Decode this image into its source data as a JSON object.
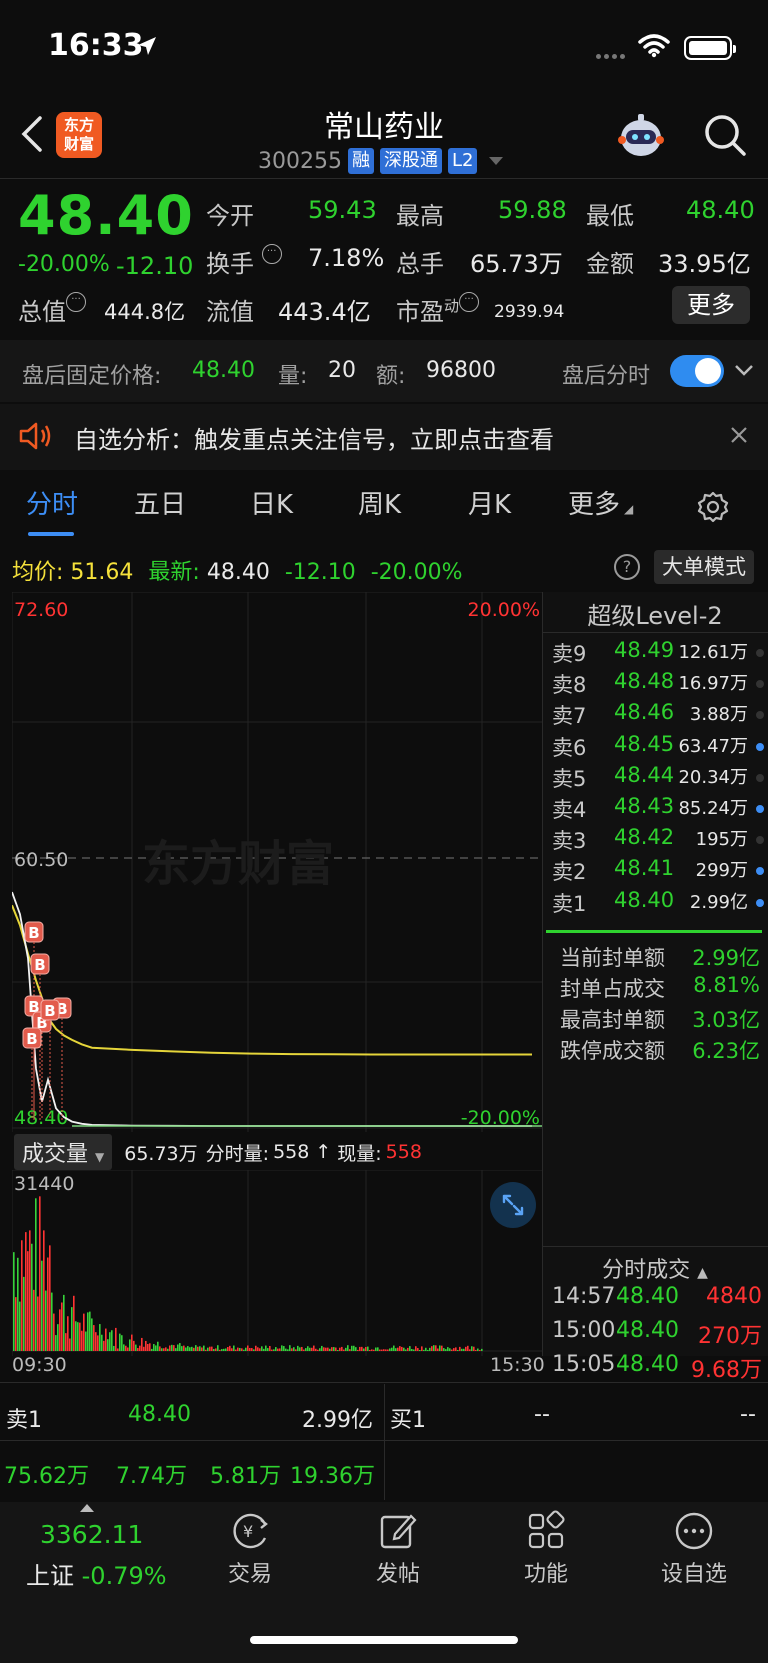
{
  "status": {
    "time": "16:33"
  },
  "header": {
    "logo_line1": "东方",
    "logo_line2": "财富",
    "title": "常山药业",
    "code": "300255",
    "tags": [
      "融",
      "深股通",
      "L2"
    ]
  },
  "quote": {
    "price": "48.40",
    "pct": "-20.00%",
    "chg": "-12.10",
    "open_label": "今开",
    "open": "59.43",
    "high_label": "最高",
    "high": "59.88",
    "low_label": "最低",
    "low": "48.40",
    "turnover_label": "换手",
    "turnover": "7.18%",
    "volume_label": "总手",
    "volume": "65.73万",
    "amount_label": "金额",
    "amount": "33.95亿",
    "mktcap_label": "总值",
    "mktcap": "444.8亿",
    "float_label": "流值",
    "float": "443.4亿",
    "pe_label": "市盈",
    "pe_sup": "动",
    "pe": "2939.94",
    "more": "更多"
  },
  "postmarket": {
    "label": "盘后固定价格:",
    "price": "48.40",
    "vol_label": "量:",
    "vol": "20",
    "amt_label": "额:",
    "amt": "96800",
    "toggle_label": "盘后分时"
  },
  "notice": {
    "text": "自选分析：触发重点关注信号，立即点击查看"
  },
  "tabs": [
    {
      "label": "分时",
      "active": true
    },
    {
      "label": "五日"
    },
    {
      "label": "日K"
    },
    {
      "label": "周K"
    },
    {
      "label": "月K"
    },
    {
      "label": "更多"
    }
  ],
  "info": {
    "avg_label": "均价:",
    "avg": "51.64",
    "last_label": "最新:",
    "last": "48.40",
    "chg": "-12.10",
    "pct": "-20.00%",
    "mode_btn": "大单模式"
  },
  "chart_data": {
    "type": "line",
    "y_top_label": "72.60",
    "y_mid_label": "60.50",
    "y_bottom_label": "48.40",
    "pct_top_label": "20.00%",
    "pct_bottom_label": "-20.00%",
    "watermark": "东方财富",
    "ylim": [
      48.4,
      72.6
    ],
    "series": [
      {
        "values": [
          58.4,
          57.5,
          56.2,
          55.0,
          54.2,
          53.3,
          52.8,
          52.5,
          52.3,
          52.1,
          51.95,
          51.85,
          51.78,
          51.72,
          51.68,
          51.66,
          51.65,
          51.64,
          51.64,
          51.64,
          51.64,
          51.64
        ]
      },
      {
        "values": [
          59.0,
          58.0,
          56.0,
          51.0,
          49.5,
          50.5,
          49.2,
          48.8,
          48.6,
          48.5,
          48.45,
          48.42,
          48.41,
          48.4,
          48.4,
          48.4,
          48.4,
          48.4,
          48.4,
          48.4,
          48.4,
          48.4
        ]
      }
    ],
    "buy_markers": [
      "B",
      "B",
      "B",
      "B",
      "B",
      "B",
      "B"
    ],
    "volume": {
      "label": "成交量",
      "total": "65.73万",
      "min_label": "分时量:",
      "min_vol": "558",
      "now_label": "现量:",
      "now_vol": "558",
      "ymax_label": "31440",
      "x_start": "09:30",
      "x_end": "15:30"
    }
  },
  "level2": {
    "title": "超级Level-2",
    "asks": [
      {
        "k": "卖9",
        "p": "48.49",
        "q": "12.61万",
        "dot": false
      },
      {
        "k": "卖8",
        "p": "48.48",
        "q": "16.97万",
        "dot": false
      },
      {
        "k": "卖7",
        "p": "48.46",
        "q": "3.88万",
        "dot": false
      },
      {
        "k": "卖6",
        "p": "48.45",
        "q": "63.47万",
        "dot": true
      },
      {
        "k": "卖5",
        "p": "48.44",
        "q": "20.34万",
        "dot": false
      },
      {
        "k": "卖4",
        "p": "48.43",
        "q": "85.24万",
        "dot": true
      },
      {
        "k": "卖3",
        "p": "48.42",
        "q": "195万",
        "dot": false
      },
      {
        "k": "卖2",
        "p": "48.41",
        "q": "299万",
        "dot": true
      },
      {
        "k": "卖1",
        "p": "48.40",
        "q": "2.99亿",
        "dot": true
      }
    ],
    "seal": [
      {
        "k": "当前封单额",
        "v": "2.99亿"
      },
      {
        "k": "封单占成交",
        "v": "8.81%"
      },
      {
        "k": "最高封单额",
        "v": "3.03亿"
      },
      {
        "k": "跌停成交额",
        "v": "6.23亿"
      }
    ],
    "trades_title": "分时成交",
    "trades": [
      {
        "t": "14:57",
        "p": "48.40",
        "q": "4840"
      },
      {
        "t": "15:00",
        "p": "48.40",
        "q": "270万"
      },
      {
        "t": "15:05",
        "p": "48.40",
        "q": "9.68万"
      }
    ]
  },
  "orderbook": {
    "sell_label": "卖1",
    "sell_price": "48.40",
    "sell_vol": "2.99亿",
    "buy_label": "买1",
    "buy_price": "--",
    "buy_vol": "--",
    "bottom": [
      "75.62万",
      "7.74万",
      "5.81万",
      "19.36万"
    ]
  },
  "bottombar": {
    "index_value": "3362.11",
    "index_name": "上证",
    "index_pct": "-0.79%",
    "items": [
      "交易",
      "发帖",
      "功能",
      "设自选"
    ]
  }
}
